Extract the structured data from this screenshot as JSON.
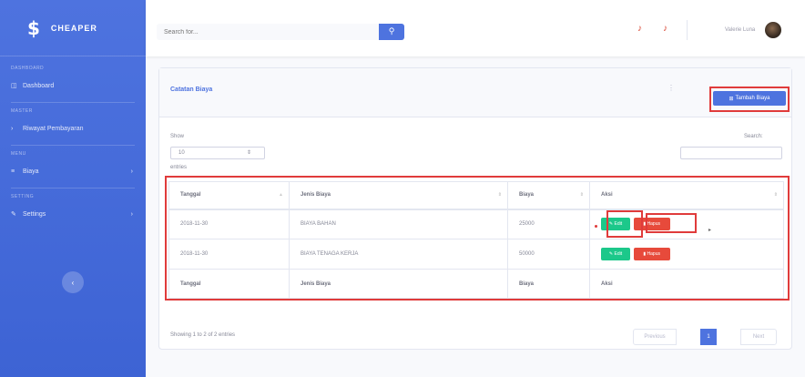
{
  "sidebar": {
    "brand_icon": "$",
    "brand_text": "CHEAPER",
    "headings": [
      "DASHBOARD",
      "MASTER",
      "MENU",
      "SETTING"
    ],
    "items": [
      {
        "icon": "dashboard-icon",
        "label": "Dashboard"
      },
      {
        "icon": "chevron-icon",
        "label": "Riwayat Pembayaran"
      },
      {
        "icon": "list-icon",
        "label": "Biaya"
      },
      {
        "icon": "wrench-icon",
        "label": "Settings"
      }
    ],
    "toggle_glyph": "‹"
  },
  "topbar": {
    "search_placeholder": "Search for...",
    "search_icon": "search-icon",
    "user_name": "Valerie Luna"
  },
  "card": {
    "title": "Catatan Biaya",
    "menu_glyph": "⋮",
    "add_button": "Tambah Biaya"
  },
  "table_controls": {
    "show_label": "Show",
    "show_value": "10",
    "entries_label": "entries",
    "search_label": "Search:"
  },
  "table": {
    "columns": [
      "Tanggal",
      "Jenis Biaya",
      "Biaya",
      "Aksi"
    ],
    "rows": [
      {
        "tanggal": "2018-11-30",
        "jenis": "BIAYA BAHAN",
        "biaya": "25000"
      },
      {
        "tanggal": "2018-11-30",
        "jenis": "BIAYA TENAGA KERJA",
        "biaya": "50000"
      }
    ],
    "edit_label": "Edit",
    "delete_label": "Hapus"
  },
  "footer": {
    "showing_text": "Showing 1 to 2 of 2 entries",
    "prev_label": "Previous",
    "page": "1",
    "next_label": "Next"
  },
  "colors": {
    "primary": "#4e73df",
    "success": "#1cc88a",
    "danger": "#e74a3b",
    "highlight": "#e03b3b"
  }
}
